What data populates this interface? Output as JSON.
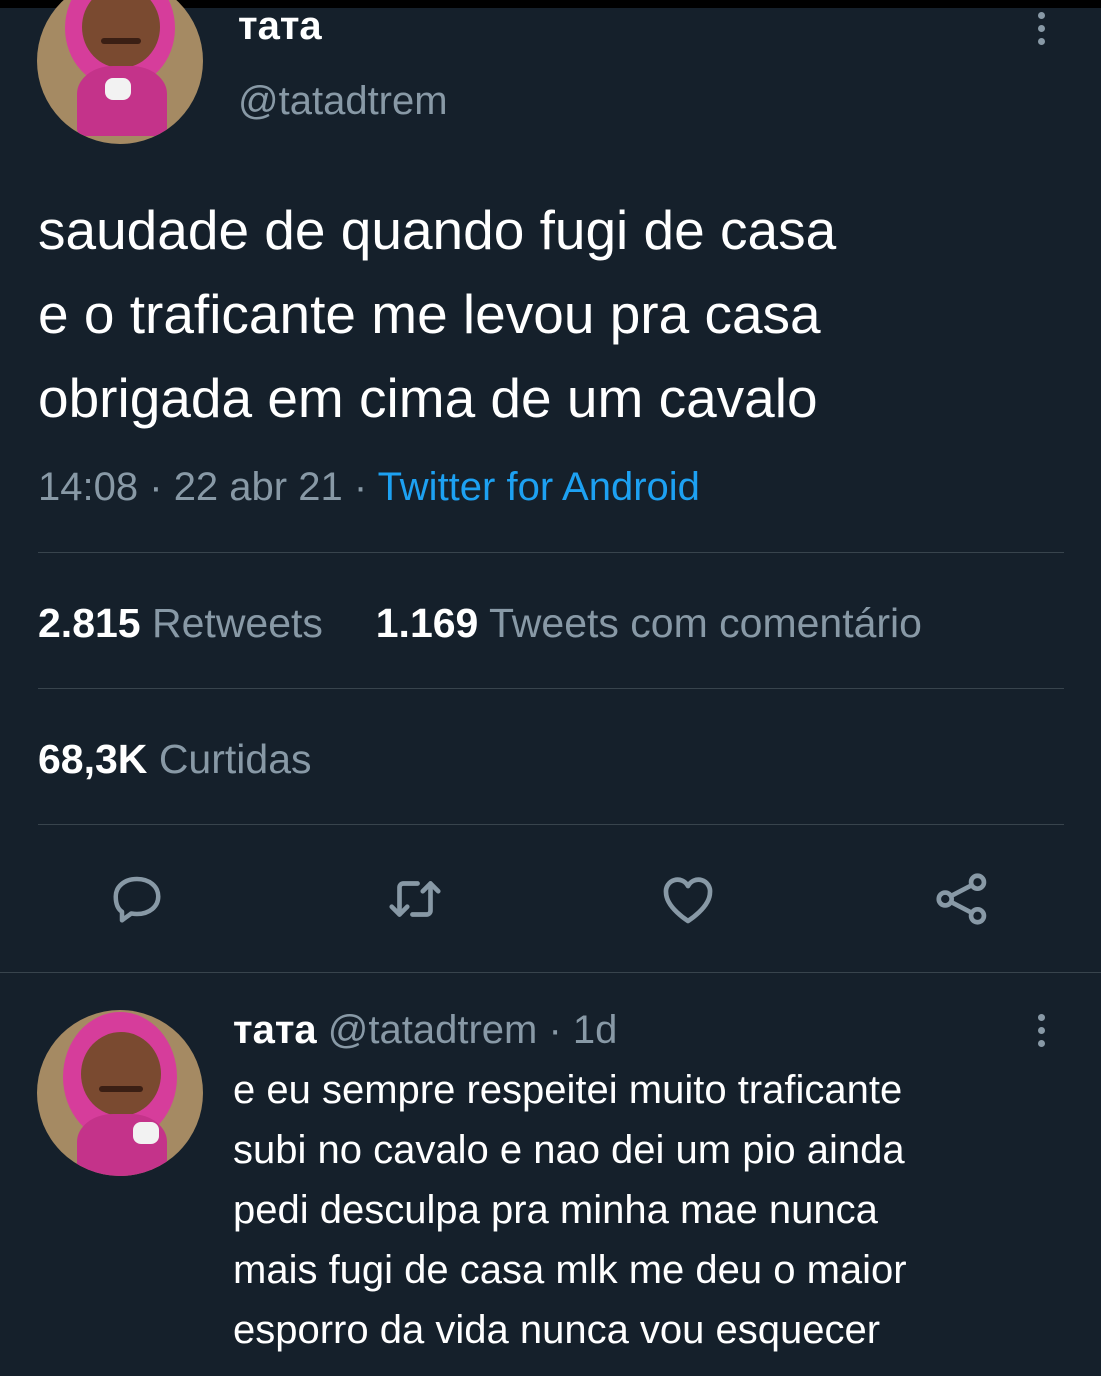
{
  "tweet": {
    "author_name": "тата",
    "author_handle": "@tatadtrem",
    "text_lines": [
      "saudade de quando fugi de casa",
      "e o traficante me levou pra casa",
      "obrigada em cima de um cavalo"
    ],
    "time": "14:08",
    "date": "22 abr 21",
    "source": "Twitter for Android",
    "separator": "·",
    "retweets_count": "2.815",
    "retweets_label": "Retweets",
    "quotes_count": "1.169",
    "quotes_label": "Tweets com comentário",
    "likes_count": "68,3K",
    "likes_label": "Curtidas"
  },
  "actions": [
    {
      "icon": "reply-icon"
    },
    {
      "icon": "retweet-icon"
    },
    {
      "icon": "like-icon"
    },
    {
      "icon": "share-icon"
    }
  ],
  "reply": {
    "author_name": "тата",
    "author_handle": "@tatadtrem",
    "age": "· 1d",
    "text_lines": [
      "e eu sempre respeitei muito traficante",
      "subi no cavalo e nao dei um pio ainda",
      "pedi desculpa pra minha mae nunca",
      "mais fugi de casa mlk me deu o maior",
      "esporro da vida nunca vou esquecer"
    ]
  },
  "colors": {
    "background": "#15202b",
    "muted": "#8899a6",
    "link": "#1da1f2",
    "divider": "#38444d"
  }
}
